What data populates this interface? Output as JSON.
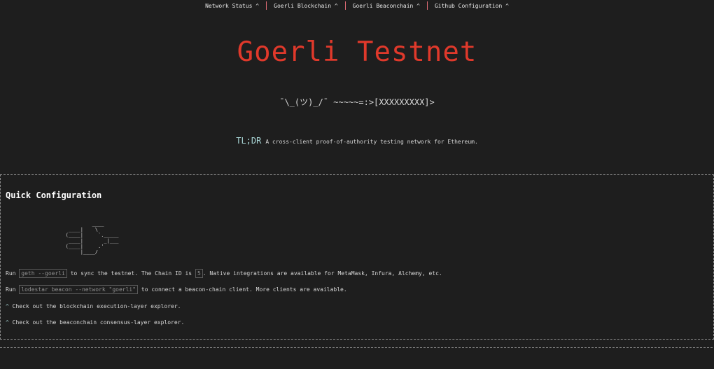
{
  "nav": {
    "items": [
      {
        "label": "Network Status ^"
      },
      {
        "label": "Goerli Blockchain ^"
      },
      {
        "label": "Goerli Beaconchain ^"
      },
      {
        "label": "Github Configuration ^"
      }
    ]
  },
  "header": {
    "title": "Goerli Testnet",
    "shrug": "¯\\_(ツ)_/¯ ~~~~~=:>[XXXXXXXXX]>",
    "tldr_label": "TL;DR",
    "tldr_text": "A cross-client proof-of-authority testing network for Ethereum."
  },
  "quick_config": {
    "heading": "Quick Configuration",
    "ascii_art": "            ____\n    ____|    \\\n   (____|     `._____\n    ____|       _|___\n   (____|     .'\n        |____/",
    "line1": {
      "prefix": "Run",
      "code": "geth --goerli",
      "middle": "to sync the testnet. The Chain ID is",
      "chain_id": "5",
      "suffix": ". Native integrations are available for MetaMask, Infura, Alchemy, etc."
    },
    "line2": {
      "prefix": "Run",
      "code": "lodestar beacon --network \"goerli\"",
      "suffix": "to connect a beacon-chain client. More clients are available."
    },
    "line3": {
      "caret": "^",
      "text": "Check out the blockchain execution-layer explorer."
    },
    "line4": {
      "caret": "^",
      "text": "Check out the beaconchain consensus-layer explorer."
    }
  }
}
